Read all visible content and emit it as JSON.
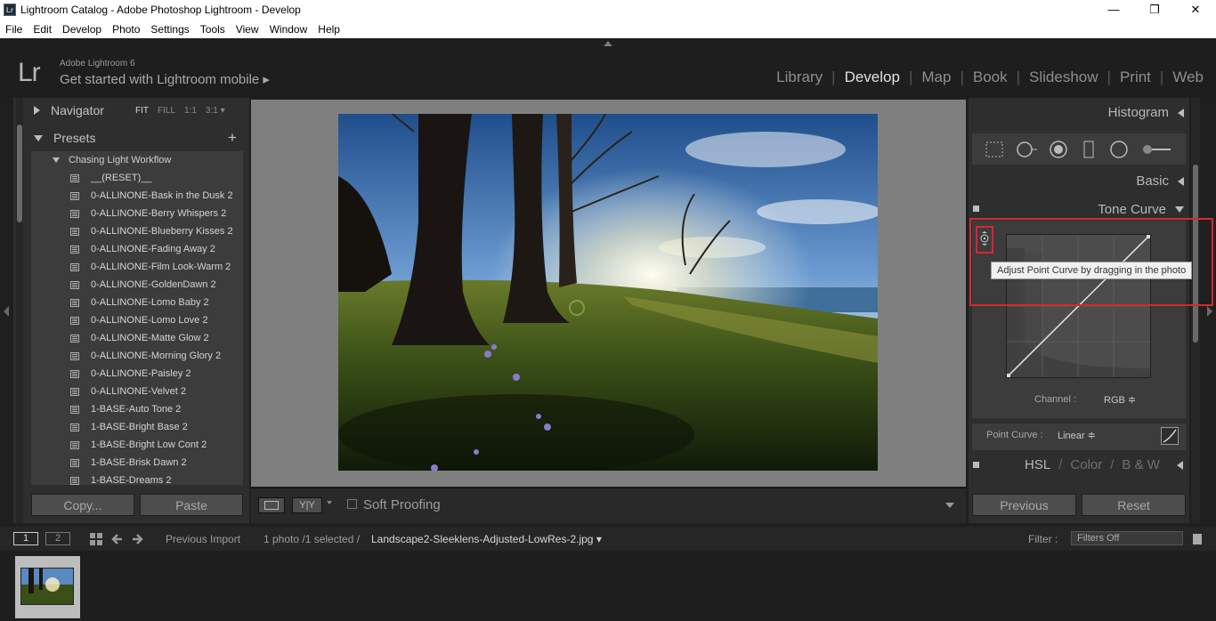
{
  "window": {
    "title": "Lightroom Catalog - Adobe Photoshop Lightroom - Develop",
    "icon": "Lr",
    "minimize": "—",
    "maximize": "❐",
    "close": "✕"
  },
  "menu": [
    "File",
    "Edit",
    "Develop",
    "Photo",
    "Settings",
    "Tools",
    "View",
    "Window",
    "Help"
  ],
  "identity": {
    "logo": "Lr",
    "product": "Adobe Lightroom 6",
    "mobile": "Get started with Lightroom mobile ▸"
  },
  "modules": [
    "Library",
    "Develop",
    "Map",
    "Book",
    "Slideshow",
    "Print",
    "Web"
  ],
  "left": {
    "navigator": "Navigator",
    "nav_options": [
      "FIT",
      "FILL",
      "1:1",
      "3:1 ▾"
    ],
    "presets": "Presets",
    "add": "+",
    "folder": "Chasing Light Workflow",
    "items": [
      "__(RESET)__",
      "0-ALLINONE-Bask in the Dusk 2",
      "0-ALLINONE-Berry Whispers 2",
      "0-ALLINONE-Blueberry Kisses 2",
      "0-ALLINONE-Fading Away 2",
      "0-ALLINONE-Film Look-Warm 2",
      "0-ALLINONE-GoldenDawn 2",
      "0-ALLINONE-Lomo Baby 2",
      "0-ALLINONE-Lomo Love 2",
      "0-ALLINONE-Matte Glow 2",
      "0-ALLINONE-Morning Glory 2",
      "0-ALLINONE-Paisley 2",
      "0-ALLINONE-Velvet 2",
      "1-BASE-Auto Tone 2",
      "1-BASE-Bright Base 2",
      "1-BASE-Bright Low Cont 2",
      "1-BASE-Brisk Dawn 2",
      "1-BASE-Dreams 2"
    ],
    "copy": "Copy...",
    "paste": "Paste"
  },
  "toolbar": {
    "soft_proofing": "Soft Proofing",
    "yy": "Y|Y"
  },
  "right": {
    "histogram": "Histogram",
    "basic": "Basic",
    "tone_curve": "Tone Curve",
    "tooltip": "Adjust Point Curve by dragging in the photo",
    "channel_label": "Channel :",
    "channel_value": "RGB ≑",
    "point_curve_label": "Point Curve :",
    "point_curve_value": "Linear ≑",
    "hsl": "HSL",
    "slash": "/",
    "color": "Color",
    "bw": "B & W",
    "previous": "Previous",
    "reset": "Reset"
  },
  "filmbar": {
    "view1": "1",
    "view2": "2",
    "source": "Previous Import",
    "count": "1 photo /1 selected /",
    "filename": "Landscape2-Sleeklens-Adjusted-LowRes-2.jpg ▾",
    "filter_label": "Filter :",
    "filter_value": "Filters Off"
  }
}
